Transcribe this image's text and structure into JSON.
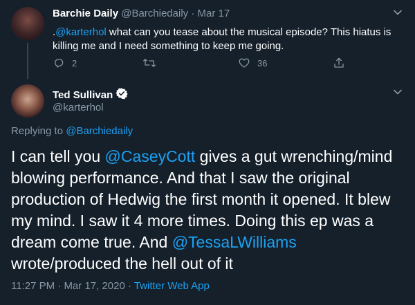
{
  "parent_tweet": {
    "name": "Barchie Daily",
    "handle": "@Barchiedaily",
    "separator": "·",
    "date": "Mar 17",
    "text_lead": ".",
    "mention": "@karterhol",
    "text_body": " what can you tease about the musical episode? This hiatus is killing me and I need something to keep me going.",
    "reply_count": "2",
    "retweet_count": "",
    "like_count": "36"
  },
  "main_tweet": {
    "name": "Ted Sullivan",
    "handle": "@karterhol",
    "replying_prefix": "Replying to ",
    "replying_to": "@Barchiedaily",
    "text_1": "I can tell you ",
    "mention_1": "@CaseyCott",
    "text_2": " gives a gut wrenching/mind blowing performance. And that I saw the original production of Hedwig the first month it opened. It blew my mind. I saw it 4 more times. Doing this ep was a dream come true. And ",
    "mention_2": "@TessaLWilliams",
    "text_3": " wrote/produced the hell out of it",
    "time": "11:27 PM",
    "separator": " · ",
    "date": "Mar 17, 2020",
    "source": "Twitter Web App"
  },
  "icons": {
    "reply": "reply-icon",
    "retweet": "retweet-icon",
    "like": "like-icon",
    "share": "share-icon",
    "verified": "verified-badge-icon",
    "caret": "chevron-down-icon"
  },
  "colors": {
    "background": "#15202b",
    "text": "#ffffff",
    "muted": "#8899a6",
    "link": "#1da1f2",
    "line": "#38444d"
  }
}
